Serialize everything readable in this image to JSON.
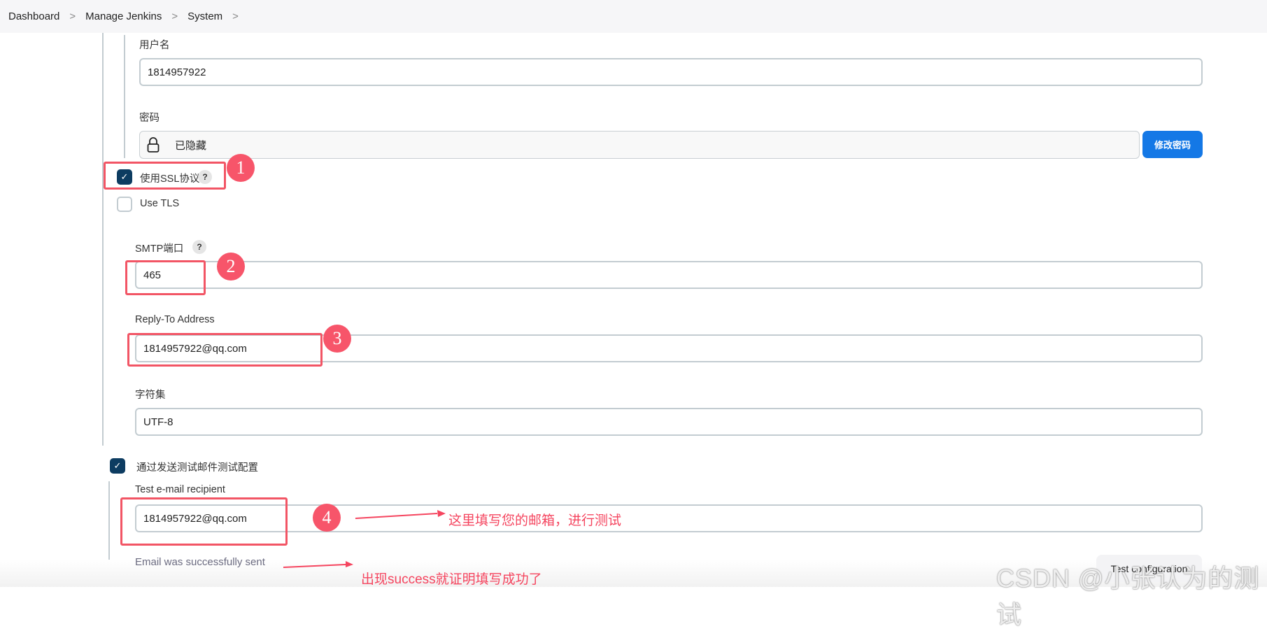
{
  "breadcrumb": {
    "items": [
      "Dashboard",
      "Manage Jenkins",
      "System"
    ],
    "separator": ">"
  },
  "auth": {
    "username_label": "用户名",
    "username_value": "1814957922",
    "password_label": "密码",
    "password_value": "已隐藏",
    "change_password_button": "修改密码"
  },
  "ssl": {
    "label": "使用SSL协议",
    "checked": true,
    "help": "?"
  },
  "tls": {
    "label": "Use TLS",
    "checked": false
  },
  "smtp_port": {
    "label": "SMTP端口",
    "help": "?",
    "value": "465"
  },
  "reply_to": {
    "label": "Reply-To Address",
    "value": "1814957922@qq.com"
  },
  "charset": {
    "label": "字符集",
    "value": "UTF-8"
  },
  "test_config": {
    "checkbox_label": "通过发送测试邮件测试配置",
    "checked": true,
    "recipient_label": "Test e-mail recipient",
    "recipient_value": "1814957922@qq.com",
    "status": "Email was successfully sent",
    "button": "Test configuration"
  },
  "annotations": {
    "markers": [
      "1",
      "2",
      "3",
      "4"
    ],
    "note_recipient": "这里填写您的邮箱，进行测试",
    "note_success": "出现success就证明填写成功了",
    "color": "#f5455f"
  },
  "watermark": "CSDN @小张认为的测试"
}
